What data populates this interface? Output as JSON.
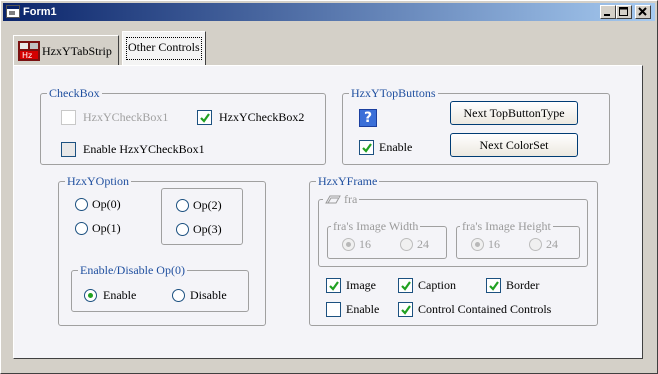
{
  "window": {
    "title": "Form1"
  },
  "tabs": [
    {
      "label": "HzxYTabStrip"
    },
    {
      "label": "Other Controls"
    }
  ],
  "checkbox_group": {
    "legend": "CheckBox",
    "checkbox1": "HzxYCheckBox1",
    "checkbox2": "HzxYCheckBox2",
    "enable": "Enable HzxYCheckBox1"
  },
  "topbuttons_group": {
    "legend": "HzxYTopButtons",
    "help_glyph": "?",
    "next_type": "Next TopButtonType",
    "next_colorset": "Next ColorSet",
    "enable": "Enable"
  },
  "option_group": {
    "legend": "HzxYOption",
    "op0": "Op(0)",
    "op1": "Op(1)",
    "op2": "Op(2)",
    "op3": "Op(3)",
    "sub_legend": "Enable/Disable Op(0)",
    "enable": "Enable",
    "disable": "Disable"
  },
  "frame_group": {
    "legend": "HzxYFrame",
    "inner_legend": "fra",
    "width_legend": "fra's Image Width",
    "height_legend": "fra's Image Height",
    "w16": "16",
    "w24": "24",
    "h16": "16",
    "h24": "24",
    "image": "Image",
    "caption": "Caption",
    "border": "Border",
    "enable": "Enable",
    "contained": "Control Contained Controls"
  },
  "icons": [
    "app-icon",
    "tabstrip-icon",
    "help-icon",
    "frame-icon",
    "check-icon"
  ],
  "colors": {
    "legend": "#1f4f9f",
    "check": "#21a121",
    "title_start": "#0a246a"
  }
}
